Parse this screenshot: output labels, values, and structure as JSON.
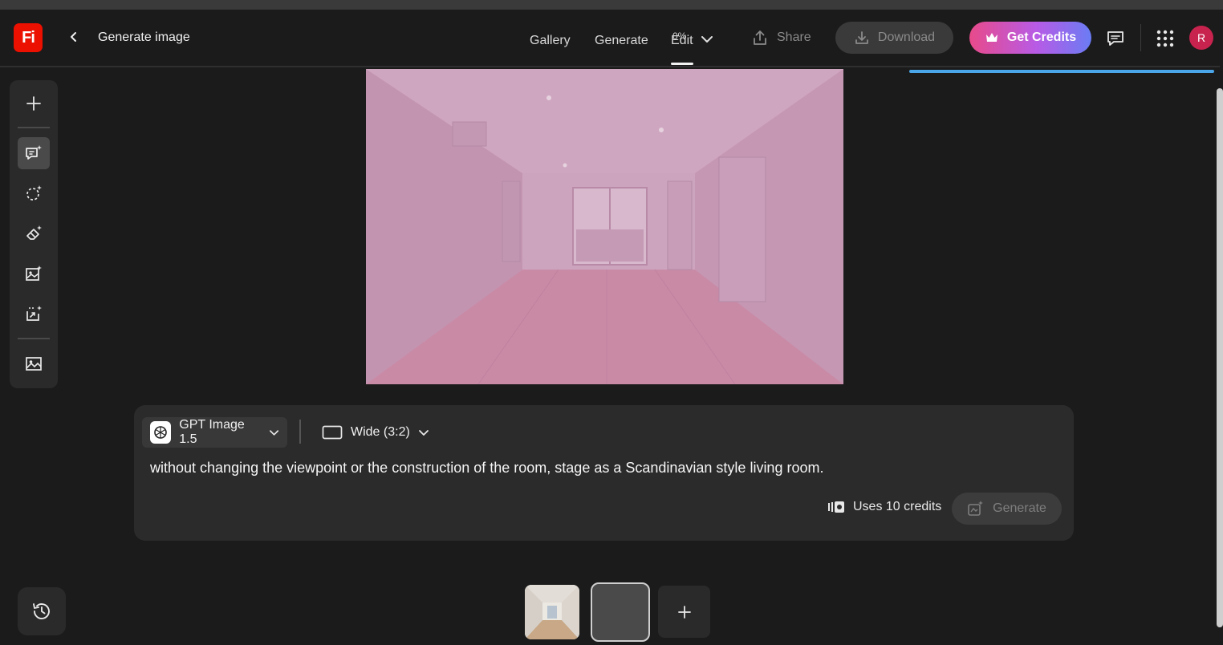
{
  "app": {
    "logo_text": "Fi",
    "page_title": "Generate image"
  },
  "nav": {
    "tabs": [
      {
        "label": "Gallery"
      },
      {
        "label": "Generate"
      },
      {
        "label": "Edit",
        "badge": "0%"
      }
    ]
  },
  "header_actions": {
    "share_label": "Share",
    "download_label": "Download",
    "credits_label": "Get Credits",
    "avatar_initial": "R"
  },
  "progress": {
    "value_percent": 100
  },
  "prompt_panel": {
    "model_label": "GPT Image 1.5",
    "ratio_label": "Wide (3:2)",
    "prompt_text": "without changing the viewpoint or the construction of the room, stage as a Scandinavian style living room.",
    "credits_text": "Uses 10 credits",
    "generate_label": "Generate"
  },
  "colors": {
    "accent_gradient_start": "#e84a8a",
    "accent_gradient_end": "#6a7cf4",
    "logo_red": "#eb1000",
    "progress_blue": "#4aa6e8",
    "avatar": "#c8234e"
  },
  "icons": {
    "left_toolbar": [
      "plus-icon",
      "chat-sparkle-icon",
      "select-sparkle-icon",
      "eraser-sparkle-icon",
      "image-sparkle-icon",
      "expand-sparkle-icon",
      "image-icon"
    ],
    "history": "history-icon"
  }
}
